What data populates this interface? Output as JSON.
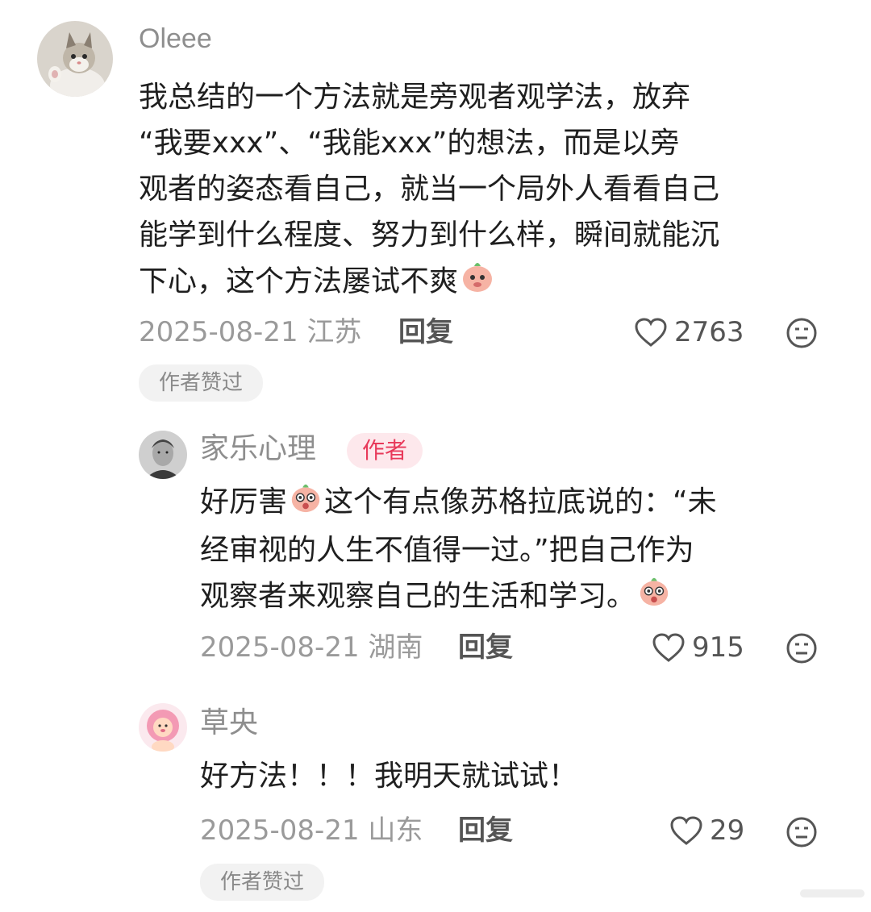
{
  "comments": [
    {
      "username": "Oleee",
      "text_lines": [
        "我总结的一个方法就是旁观者观学法，放弃",
        "“我要xxx”、“我能xxx”的想法，而是以旁",
        "观者的姿态看自己，就当一个局外人看看自己",
        "能学到什么程度、努力到什么样，瞬间就能沉",
        "下心，这个方法屡试不爽"
      ],
      "date_location": "2025-08-21 江苏",
      "reply_label": "回复",
      "likes": "2763",
      "badge": "作者赞过",
      "avatar_icon": "cat-avatar-icon"
    },
    {
      "username": "家乐心理",
      "author_tag": "作者",
      "text_lines": [
        "好厉害",
        "这个有点像苏格拉底说的：“未",
        "经审视的人生不值得一过。”把自己作为",
        "观察者来观察自己的生活和学习。"
      ],
      "date_location": "2025-08-21 湖南",
      "reply_label": "回复",
      "likes": "915",
      "avatar_icon": "man-portrait-avatar-icon"
    },
    {
      "username": "草央",
      "text_lines": [
        "好方法！！！我明天就试试！"
      ],
      "date_location": "2025-08-21 山东",
      "reply_label": "回复",
      "likes": "29",
      "badge": "作者赞过",
      "avatar_icon": "pink-lion-avatar-icon"
    }
  ],
  "colors": {
    "author_tag_bg": "#fde8ec",
    "author_tag_text": "#e8395a",
    "badge_bg": "#f2f2f2"
  }
}
